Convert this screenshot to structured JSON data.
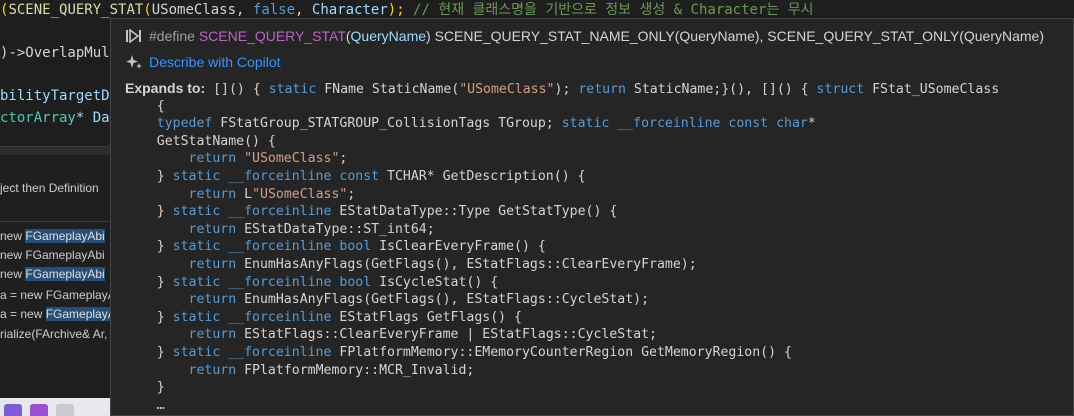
{
  "editor": {
    "line1": {
      "paren_open": "(",
      "fn": "SCENE_QUERY_STAT",
      "args_open": "(",
      "cls": "USomeClass",
      "rest1": ", ",
      "kw_false": "false",
      "rest2": ", ",
      "arg3": "Character",
      "close": ");",
      "comment": " // 현재 클래스명을 기반으로 정보 생성 & Character는 무시"
    },
    "line2": {
      "text": ")->OverlapMult"
    },
    "line3": {
      "text": "bilityTargetDa"
    },
    "line4": {
      "type": "ctorArray",
      "rest": "* Dat"
    }
  },
  "side_panel": {
    "header_text": "ject then Definition",
    "refs": [
      {
        "prefix": " new ",
        "hl": "FGameplayAbi",
        "suffix": ""
      },
      {
        "prefix": " new FGameplayAbi",
        "hl": "",
        "suffix": ""
      },
      {
        "prefix": " new ",
        "hl": "FGameplayAbi",
        "suffix": ""
      },
      {
        "prefix": "a = new FGameplayA",
        "hl": "",
        "suffix": ""
      },
      {
        "prefix": "a = new ",
        "hl": "FGameplayA",
        "suffix": ""
      },
      {
        "prefix": "rialize(FArchive& Ar, ",
        "hl": "",
        "suffix": ""
      }
    ]
  },
  "hover": {
    "signature": {
      "define_kw": "#define ",
      "macro": "SCENE_QUERY_STAT",
      "param_open": "(",
      "param": "QueryName",
      "param_close": ") ",
      "body1": "SCENE_QUERY_STAT_NAME_ONLY(QueryName), SCENE_QUERY_STAT_ONLY(QueryName)"
    },
    "copilot_label": "Describe with Copilot",
    "expands_label": "Expands to:",
    "expansion": {
      "l0": {
        "a": " []() { ",
        "k1": "static",
        "b": " FName StaticName(",
        "s1": "\"USomeClass\"",
        "c": "); ",
        "k2": "return",
        "d": " StaticName;}(), []() { ",
        "k3": "struct",
        "e": " FStat_USomeClass"
      },
      "l1": "    {",
      "l2": {
        "ind": "    ",
        "k1": "typedef",
        "a": " FStatGroup_STATGROUP_CollisionTags TGroup; ",
        "k2": "static",
        "k3": " __forceinline",
        "k4": " const",
        "k5": " char",
        "b": "*"
      },
      "l3": "    GetStatName() {",
      "l4": {
        "ind": "        ",
        "k": "return",
        "s": " \"USomeClass\"",
        "end": ";"
      },
      "l5": {
        "ind": "    } ",
        "k1": "static",
        "k2": " __forceinline",
        "k3": " const",
        "a": " TCHAR* GetDescription() {"
      },
      "l6": {
        "ind": "        ",
        "k": "return",
        "a": " L",
        "s": "\"USomeClass\"",
        "end": ";"
      },
      "l7": {
        "ind": "    } ",
        "k1": "static",
        "k2": " __forceinline",
        "a": " EStatDataType::Type GetStatType() {"
      },
      "l8": {
        "ind": "        ",
        "k": "return",
        "a": " EStatDataType::ST_int64;"
      },
      "l9": {
        "ind": "    } ",
        "k1": "static",
        "k2": " __forceinline",
        "k3": " bool",
        "a": " IsClearEveryFrame() {"
      },
      "l10": {
        "ind": "        ",
        "k": "return",
        "a": " EnumHasAnyFlags(GetFlags(), EStatFlags::ClearEveryFrame);"
      },
      "l11": {
        "ind": "    } ",
        "k1": "static",
        "k2": " __forceinline",
        "k3": " bool",
        "a": " IsCycleStat() {"
      },
      "l12": {
        "ind": "        ",
        "k": "return",
        "a": " EnumHasAnyFlags(GetFlags(), EStatFlags::CycleStat);"
      },
      "l13": {
        "ind": "    } ",
        "k1": "static",
        "k2": " __forceinline",
        "a": " EStatFlags GetFlags() {"
      },
      "l14": {
        "ind": "        ",
        "k": "return",
        "a": " EStatFlags::ClearEveryFrame | EStatFlags::CycleStat;"
      },
      "l15": {
        "ind": "    } ",
        "k1": "static",
        "k2": " __forceinline",
        "a": " FPlatformMemory::EMemoryCounterRegion GetMemoryRegion() {"
      },
      "l16": {
        "ind": "        ",
        "k": "return",
        "a": " FPlatformMemory::MCR_Invalid;"
      },
      "l17": "    }",
      "l18": "    …"
    }
  }
}
